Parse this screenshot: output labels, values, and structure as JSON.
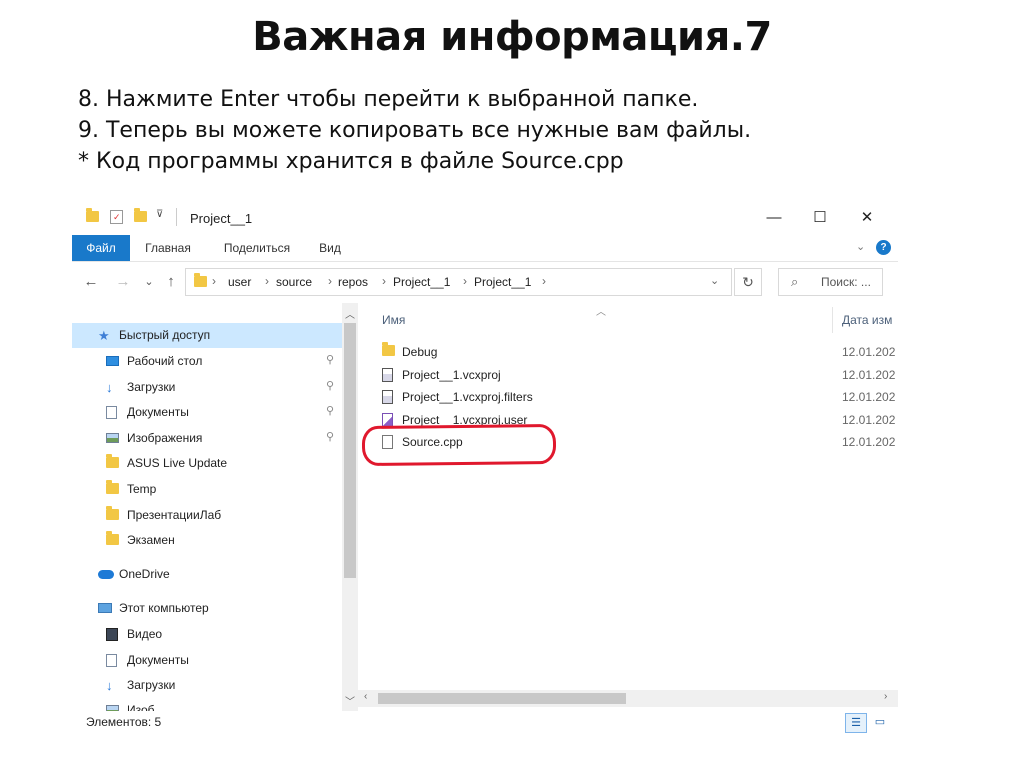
{
  "slide": {
    "title": "Важная информация.7",
    "lines": [
      "8. Нажмите Enter чтобы перейти к выбранной папке.",
      "9. Теперь вы можете копировать все нужные вам файлы.",
      "* Код программы хранится в файле Source.cpp"
    ]
  },
  "window": {
    "title": "Project__1",
    "minimize": "—",
    "maximize": "☐",
    "close": "✕",
    "ribbon_tabs": [
      "Файл",
      "Главная",
      "Поделиться",
      "Вид"
    ],
    "active_tab": "Файл",
    "accent_color": "#1979ca",
    "nav_back": "←",
    "nav_forward": "→",
    "nav_recent": "⌄",
    "nav_up": "↑",
    "address": [
      "user",
      "source",
      "repos",
      "Project__1",
      "Project__1"
    ],
    "refresh": "↻",
    "search_placeholder": "Поиск: ...",
    "search_icon": "⌕"
  },
  "navigation": {
    "items": [
      {
        "label": "Быстрый доступ",
        "icon": "star-icon",
        "selected": true
      },
      {
        "label": "Рабочий стол",
        "icon": "desktop-icon",
        "pinned": true
      },
      {
        "label": "Загрузки",
        "icon": "download-icon",
        "pinned": true
      },
      {
        "label": "Документы",
        "icon": "document-icon",
        "pinned": true
      },
      {
        "label": "Изображения",
        "icon": "image-icon",
        "pinned": true
      },
      {
        "label": "ASUS Live Update",
        "icon": "folder-icon"
      },
      {
        "label": "Temp",
        "icon": "folder-icon"
      },
      {
        "label": "ПрезентацииЛаб",
        "icon": "folder-icon"
      },
      {
        "label": "Экзамен",
        "icon": "folder-icon"
      },
      {
        "label": "OneDrive",
        "icon": "cloud-icon"
      },
      {
        "label": "Этот компьютер",
        "icon": "computer-icon"
      },
      {
        "label": "Видео",
        "icon": "video-icon"
      },
      {
        "label": "Документы",
        "icon": "document-icon"
      },
      {
        "label": "Загрузки",
        "icon": "download-icon"
      },
      {
        "label": "Изоб",
        "icon": "image-icon"
      }
    ]
  },
  "content": {
    "columns": {
      "name": "Имя",
      "date": "Дата изм"
    },
    "files": [
      {
        "name": "Debug",
        "date": "12.01.202",
        "icon": "folder-icon"
      },
      {
        "name": "Project__1.vcxproj",
        "date": "12.01.202",
        "icon": "project-file-icon"
      },
      {
        "name": "Project__1.vcxproj.filters",
        "date": "12.01.202",
        "icon": "filters-file-icon"
      },
      {
        "name": "Project__1.vcxproj.user",
        "date": "12.01.202",
        "icon": "vs-file-icon"
      },
      {
        "name": "Source.cpp",
        "date": "12.01.202",
        "icon": "cpp-file-icon",
        "highlighted": true
      }
    ],
    "highlight_color": "#e0182d"
  },
  "status": {
    "items_text": "Элементов: 5",
    "view_details": "☰",
    "view_icons": "▭"
  }
}
